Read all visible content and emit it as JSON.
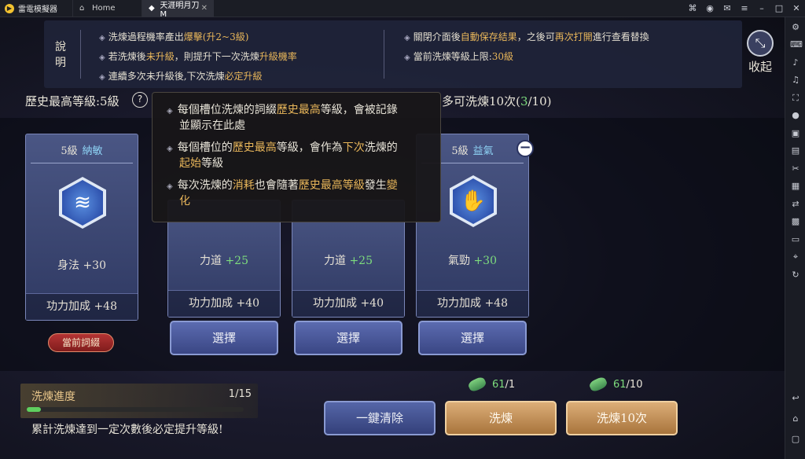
{
  "titlebar": {
    "emulator_name": "雷電模擬器",
    "tabs": [
      {
        "label": "Home",
        "icon": "home-icon"
      },
      {
        "label": "天涯明月刀 M",
        "icon": "game-icon"
      }
    ]
  },
  "info": {
    "explain_label": "說明",
    "lines": {
      "l1_a": "洗煉過程機率產出",
      "l1_b": "爆擊(升2~3級)",
      "l2_a": "若洗煉後",
      "l2_b": "未升級",
      "l2_c": "，則提升下一次洗煉",
      "l2_d": "升級機率",
      "l3_a": "連續多次未升級後,下次洗煉",
      "l3_b": "必定升級",
      "r1_a": "關閉介面後",
      "r1_b": "自動保存結果",
      "r1_c": "，之後可",
      "r1_d": "再次打開",
      "r1_e": "進行查看替換",
      "r2_a": "當前洗煉等級上限:",
      "r2_b": "30級"
    },
    "collapse_label": "收起"
  },
  "history": {
    "label": "歷史最高等級:5級",
    "help": "?"
  },
  "can_wash": {
    "prefix": "多可洗煉10次(",
    "count": "3",
    "suffix": "/10)"
  },
  "tooltip": {
    "t1_a": "每個槽位洗煉的詞綴",
    "t1_b": "歷史最高",
    "t1_c": "等級，會被記錄",
    "t1_d": "並顯示在此處",
    "t2_a": "每個槽位的",
    "t2_b": "歷史最高",
    "t2_c": "等級，會作為",
    "t2_d": "下次",
    "t2_e": "洗煉的",
    "t2_f": "起始",
    "t2_g": "等級",
    "t3_a": "每次洗煉的",
    "t3_b": "消耗",
    "t3_c": "也會隨著",
    "t3_d": "歷史最高等級",
    "t3_e": "發生",
    "t3_f": "變",
    "t3_g": "化"
  },
  "current_card": {
    "level": "5級",
    "name": "納敏",
    "stat_name": "身法",
    "stat_value": "+30",
    "bonus": "功力加成 +48",
    "badge": "當前詞綴",
    "icon": "agility-icon"
  },
  "option_cards": [
    {
      "stat_name": "力道",
      "stat_value": "+25",
      "bonus": "功力加成 +40",
      "select": "選擇"
    },
    {
      "stat_name": "力道",
      "stat_value": "+25",
      "bonus": "功力加成 +40",
      "select": "選擇"
    },
    {
      "level": "5級",
      "name": "益氣",
      "stat_name": "氣勁",
      "stat_value": "+30",
      "bonus": "功力加成 +48",
      "select": "選擇",
      "icon": "palm-icon"
    }
  ],
  "progress": {
    "title": "洗煉進度",
    "count": "1/15",
    "fraction": 0.067,
    "hint": "累計洗煉達到一定次數後必定提升等級!"
  },
  "costs": [
    {
      "have": "61",
      "need": "/1"
    },
    {
      "have": "61",
      "need": "/10"
    }
  ],
  "buttons": {
    "clear": "一鍵清除",
    "wash": "洗煉",
    "wash10": "洗煉10次"
  },
  "colors": {
    "highlight": "#e8b65a",
    "green": "#7ddc7d"
  }
}
